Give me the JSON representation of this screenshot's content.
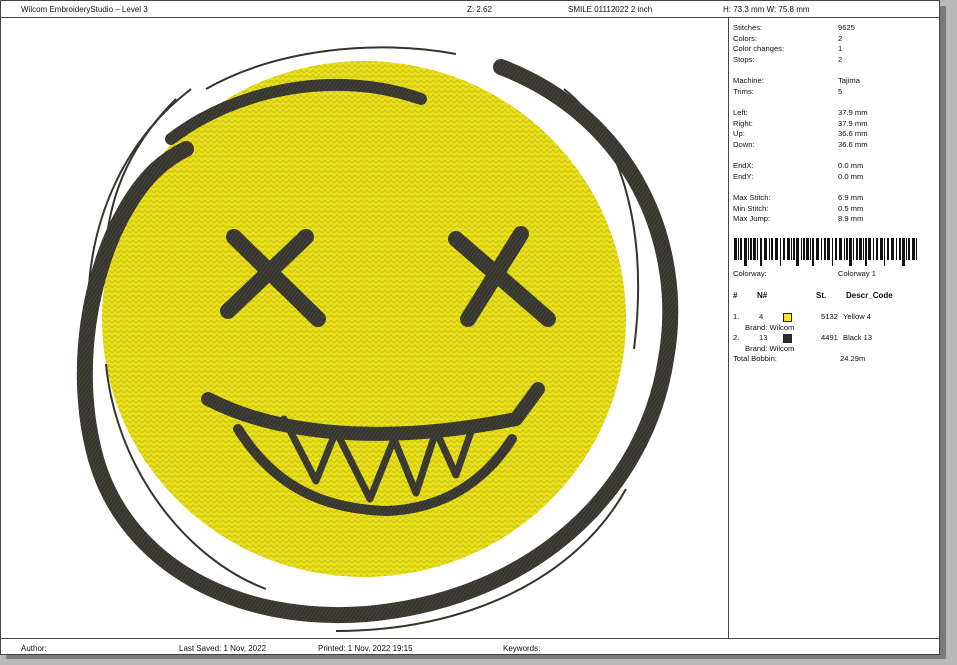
{
  "header": {
    "app_title": "Wilcom EmbroideryStudio – Level 3",
    "zoom": "Z: 2.62",
    "design_name": "SMILE 01112022 2 inch",
    "dimensions": "H: 73.3 mm   W: 75.8 mm"
  },
  "stats": [
    {
      "label": "Stitches:",
      "value": "9625"
    },
    {
      "label": "Colors:",
      "value": "2"
    },
    {
      "label": "Color changes:",
      "value": "1"
    },
    {
      "label": "Stops:",
      "value": "2"
    },
    {
      "label": "Machine:",
      "value": "Tajima"
    },
    {
      "label": "Trims:",
      "value": "5"
    },
    {
      "label": "Left:",
      "value": "37.9 mm"
    },
    {
      "label": "Right:",
      "value": "37.9 mm"
    },
    {
      "label": "Up:",
      "value": "36.6 mm"
    },
    {
      "label": "Down:",
      "value": "36.6 mm"
    },
    {
      "label": "EndX:",
      "value": "0.0 mm"
    },
    {
      "label": "EndY:",
      "value": "0.0 mm"
    },
    {
      "label": "Max Stitch:",
      "value": "6.9 mm"
    },
    {
      "label": "Min Stitch:",
      "value": "0.5 mm"
    },
    {
      "label": "Max Jump:",
      "value": "8.9 mm"
    }
  ],
  "colorway": {
    "label": "Colorway:",
    "value": "Colorway 1"
  },
  "color_table": {
    "headers": [
      "#",
      "N#",
      "St.",
      "Descr_Code"
    ],
    "rows": [
      {
        "index": "1.",
        "number": "4",
        "swatch": "#f5e61a",
        "stitches": "5132",
        "descr": "Yellow 4",
        "brand": "Brand: Wilcom"
      },
      {
        "index": "2.",
        "number": "13",
        "swatch": "#2e2e28",
        "stitches": "4491",
        "descr": "Black 13",
        "brand": "Brand: Wilcom"
      }
    ],
    "total_label": "Total Bobbin:",
    "total_value": "24.29m"
  },
  "footer": {
    "author": "Author:",
    "last_saved": "Last Saved:  1 Nov, 2022",
    "printed": "Printed:  1 Nov, 2022 19:15",
    "keywords": "Keywords:"
  },
  "colors": {
    "yellow": "#eae11c",
    "thread_dark": "#35352e",
    "sheet": "#ffffff",
    "backdrop": "#b9b9b9"
  },
  "icons": {
    "design": "smiley-x-eyes-embroidery"
  }
}
